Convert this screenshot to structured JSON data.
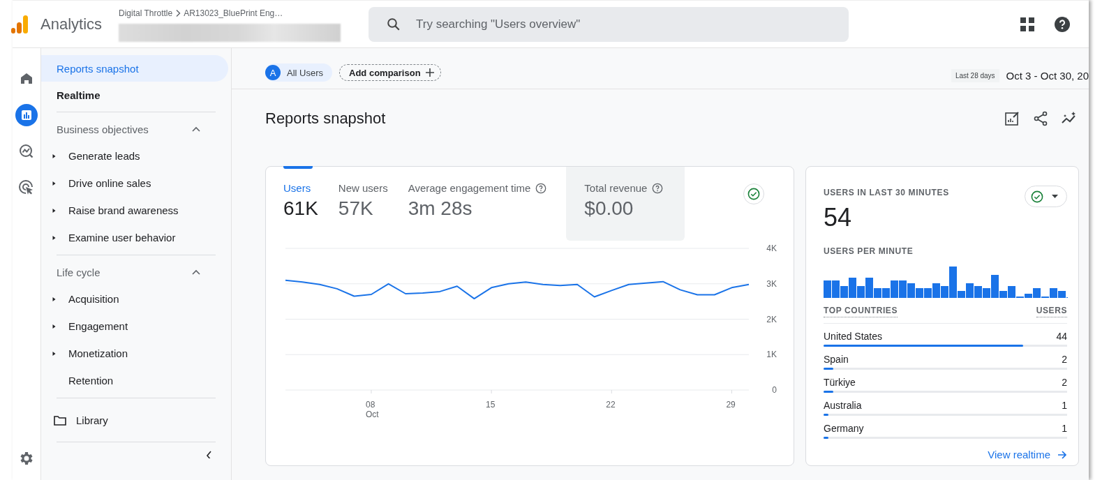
{
  "header": {
    "product": "Analytics",
    "breadcrumb": [
      "Digital Throttle",
      "AR13023_BluePrint Eng…"
    ],
    "search": {
      "placeholder": "Try searching \"Users overview\""
    }
  },
  "rail": [
    {
      "kind": "home",
      "selected": false
    },
    {
      "kind": "reports",
      "selected": true
    },
    {
      "kind": "explore",
      "selected": false
    },
    {
      "kind": "advertising",
      "selected": false
    },
    {
      "kind": "admin",
      "selected": false
    }
  ],
  "sidebar": {
    "items": [
      {
        "label": "Reports snapshot",
        "selected": true
      },
      {
        "label": "Realtime",
        "selected": false
      }
    ],
    "sections": [
      {
        "title": "Business objectives",
        "expanded": true,
        "children": [
          {
            "label": "Generate leads",
            "expandable": true
          },
          {
            "label": "Drive online sales",
            "expandable": true
          },
          {
            "label": "Raise brand awareness",
            "expandable": true
          },
          {
            "label": "Examine user behavior",
            "expandable": true
          }
        ]
      },
      {
        "title": "Life cycle",
        "expanded": true,
        "children": [
          {
            "label": "Acquisition",
            "expandable": true
          },
          {
            "label": "Engagement",
            "expandable": true
          },
          {
            "label": "Monetization",
            "expandable": true
          },
          {
            "label": "Retention",
            "expandable": false
          }
        ]
      }
    ],
    "library": "Library"
  },
  "toolbar": {
    "comparisons": [
      {
        "badge": "A",
        "label": "All Users"
      }
    ],
    "add_comparison": "Add comparison",
    "date_preset": "Last 28 days",
    "date_range": "Oct 3 - Oct 30, 20"
  },
  "page_title": "Reports snapshot",
  "overview_card": {
    "metrics": [
      {
        "label": "Users",
        "value": "61K",
        "selected": true,
        "help": false,
        "highlighted": false
      },
      {
        "label": "New users",
        "value": "57K",
        "selected": false,
        "help": false,
        "highlighted": false
      },
      {
        "label": "Average engagement time",
        "value": "3m 28s",
        "selected": false,
        "help": true,
        "highlighted": false
      },
      {
        "label": "Total revenue",
        "value": "$0.00",
        "selected": false,
        "help": true,
        "highlighted": true
      }
    ],
    "chart_data": {
      "type": "line",
      "x": [
        3,
        4,
        5,
        6,
        7,
        8,
        9,
        10,
        11,
        12,
        13,
        14,
        15,
        16,
        17,
        18,
        19,
        20,
        21,
        22,
        23,
        24,
        25,
        26,
        27,
        28,
        29,
        30
      ],
      "grid": true,
      "series": [
        {
          "color": "#1a73e8",
          "values": [
            3100,
            3050,
            2980,
            2860,
            2650,
            2700,
            3000,
            2720,
            2740,
            2780,
            2930,
            2580,
            2890,
            3000,
            3050,
            2980,
            2950,
            2980,
            2630,
            2810,
            2980,
            3020,
            3060,
            2830,
            2690,
            2690,
            2890,
            2980
          ]
        }
      ],
      "xlim": [
        3,
        30
      ],
      "ylim": [
        0,
        4000
      ],
      "xticks": [
        {
          "value": 8,
          "label": "08\nOct"
        },
        15,
        22,
        29
      ],
      "yticks": [
        {
          "value": 0,
          "label": "0"
        },
        {
          "value": 1000,
          "label": "1K"
        },
        {
          "value": 2000,
          "label": "2K"
        },
        {
          "value": 3000,
          "label": "3K"
        },
        {
          "value": 4000,
          "label": "4K"
        }
      ]
    }
  },
  "realtime_card": {
    "title": "USERS IN LAST 30 MINUTES",
    "value": "54",
    "subtitle": "USERS PER MINUTE",
    "columns": [
      "TOP COUNTRIES",
      "USERS"
    ],
    "rows": [
      {
        "name": "United States",
        "value": "44",
        "level": 0.82
      },
      {
        "name": "Spain",
        "value": "2",
        "level": 0.04
      },
      {
        "name": "Türkiye",
        "value": "2",
        "level": 0.04
      },
      {
        "name": "Australia",
        "value": "1",
        "level": 0.02
      },
      {
        "name": "Germany",
        "value": "1",
        "level": 0.02
      }
    ],
    "link": "View realtime"
  }
}
